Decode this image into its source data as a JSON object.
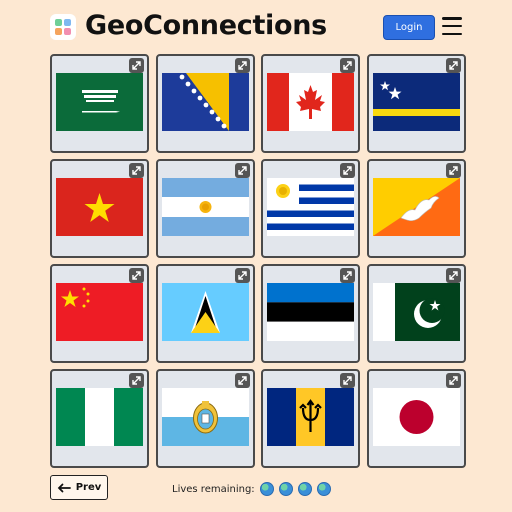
{
  "header": {
    "title": "GeoConnections",
    "login_label": "Login",
    "menu_icon": "hamburger-menu-icon",
    "logo_icon": "app-logo-icon",
    "logo_colors": [
      "#6fcf97",
      "#7fb8f0",
      "#f5a45d",
      "#f28fb1"
    ]
  },
  "board": {
    "flags": [
      {
        "country": "saudi-arabia"
      },
      {
        "country": "bosnia-and-herzegovina"
      },
      {
        "country": "canada"
      },
      {
        "country": "curacao"
      },
      {
        "country": "vietnam"
      },
      {
        "country": "argentina"
      },
      {
        "country": "uruguay"
      },
      {
        "country": "bhutan"
      },
      {
        "country": "china"
      },
      {
        "country": "saint-lucia"
      },
      {
        "country": "estonia"
      },
      {
        "country": "pakistan"
      },
      {
        "country": "nigeria"
      },
      {
        "country": "san-marino"
      },
      {
        "country": "barbados"
      },
      {
        "country": "japan"
      }
    ],
    "expand_icon": "expand-arrows-icon"
  },
  "footer": {
    "prev_label": "Prev",
    "prev_icon": "arrow-left-icon",
    "lives_label": "Lives remaining:",
    "lives": 4,
    "lives_icon": "globe-icon"
  },
  "colors": {
    "background": "#fde8d2",
    "card": "#e2e6ec",
    "login_button": "#2f6fe0"
  }
}
